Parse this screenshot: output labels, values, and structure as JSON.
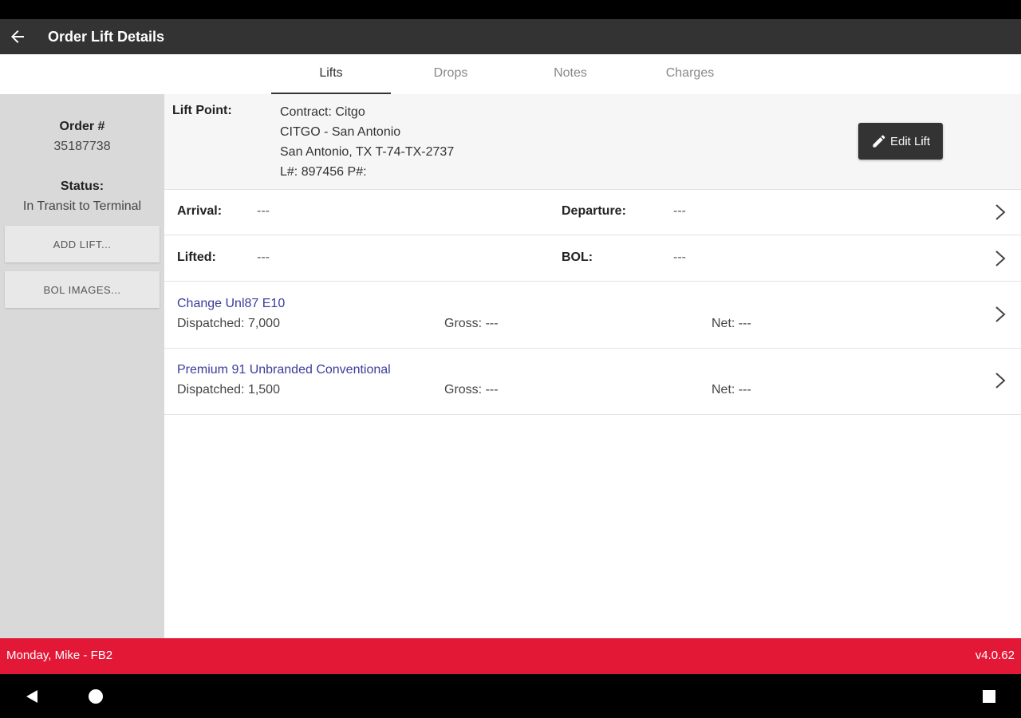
{
  "app_bar": {
    "title": "Order Lift Details"
  },
  "tabs": [
    {
      "label": "Lifts",
      "active": true
    },
    {
      "label": "Drops",
      "active": false
    },
    {
      "label": "Notes",
      "active": false
    },
    {
      "label": "Charges",
      "active": false
    }
  ],
  "sidebar": {
    "order_label": "Order #",
    "order_value": "35187738",
    "status_label": "Status:",
    "status_value": "In Transit to Terminal",
    "add_lift_label": "ADD LIFT...",
    "bol_images_label": "BOL IMAGES..."
  },
  "lift_point": {
    "label": "Lift Point:",
    "line1": "Contract: Citgo",
    "line2": "CITGO - San Antonio",
    "line3": "San Antonio, TX T-74-TX-2737",
    "line4": "L#: 897456 P#:",
    "edit_label": "Edit Lift"
  },
  "times": {
    "arrival_label": "Arrival:",
    "arrival_value": "---",
    "departure_label": "Departure:",
    "departure_value": "---",
    "lifted_label": "Lifted:",
    "lifted_value": "---",
    "bol_label": "BOL:",
    "bol_value": "---"
  },
  "products": [
    {
      "name": "Change Unl87 E10",
      "dispatched": "Dispatched: 7,000",
      "gross": "Gross: ---",
      "net": "Net: ---"
    },
    {
      "name": "Premium 91 Unbranded Conventional",
      "dispatched": "Dispatched: 1,500",
      "gross": "Gross: ---",
      "net": "Net: ---"
    }
  ],
  "footer": {
    "user": "Monday, Mike - FB2",
    "version": "v4.0.62",
    "accent_color": "#e31837"
  },
  "icons": [
    "back-arrow-icon",
    "pencil-icon",
    "chevron-right-icon",
    "nav-back-icon",
    "nav-home-icon",
    "nav-recents-icon"
  ]
}
